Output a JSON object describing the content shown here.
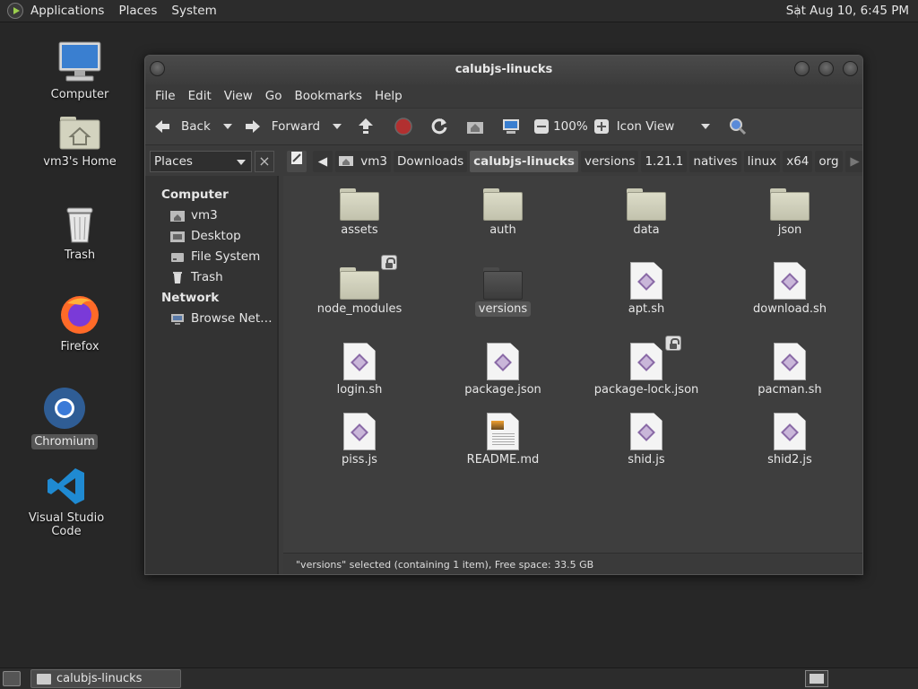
{
  "top_panel": {
    "menus": [
      "Applications",
      "Places",
      "System"
    ],
    "clock": "Sat Aug 10,  6:45 PM"
  },
  "desktop_icons": [
    {
      "label": "Computer",
      "icon": "computer-icon"
    },
    {
      "label": "vm3's Home",
      "icon": "home-folder-icon"
    },
    {
      "label": "Trash",
      "icon": "trash-icon"
    },
    {
      "label": "Firefox",
      "icon": "firefox-icon"
    },
    {
      "label": "Chromium",
      "icon": "chromium-icon",
      "selected": true
    },
    {
      "label": "Visual Studio Code",
      "icon": "vscode-icon"
    }
  ],
  "window": {
    "title": "calubjs-linucks",
    "menu": [
      "File",
      "Edit",
      "View",
      "Go",
      "Bookmarks",
      "Help"
    ],
    "toolbar": {
      "back": "Back",
      "forward": "Forward",
      "zoom": "100%",
      "view_mode": "Icon View"
    },
    "places_combo": "Places",
    "breadcrumbs": [
      "vm3",
      "Downloads",
      "calubjs-linucks",
      "versions",
      "1.21.1",
      "natives",
      "linux",
      "x64",
      "org"
    ],
    "active_crumb": "calubjs-linucks",
    "sidebar": {
      "computer_head": "Computer",
      "computer_items": [
        {
          "label": "vm3",
          "icon": "home-icon"
        },
        {
          "label": "Desktop",
          "icon": "desktop-icon"
        },
        {
          "label": "File System",
          "icon": "drive-icon"
        },
        {
          "label": "Trash",
          "icon": "trash-icon"
        }
      ],
      "network_head": "Network",
      "network_items": [
        {
          "label": "Browse Net…",
          "icon": "network-icon"
        }
      ]
    },
    "files": [
      {
        "name": "assets",
        "type": "folder"
      },
      {
        "name": "auth",
        "type": "folder"
      },
      {
        "name": "data",
        "type": "folder"
      },
      {
        "name": "json",
        "type": "folder"
      },
      {
        "name": "node_modules",
        "type": "folder",
        "locked": true
      },
      {
        "name": "versions",
        "type": "folder",
        "selected": true
      },
      {
        "name": "apt.sh",
        "type": "script"
      },
      {
        "name": "download.sh",
        "type": "script"
      },
      {
        "name": "login.sh",
        "type": "script"
      },
      {
        "name": "package.json",
        "type": "script"
      },
      {
        "name": "package-lock.json",
        "type": "script",
        "locked": true
      },
      {
        "name": "pacman.sh",
        "type": "script"
      },
      {
        "name": "piss.js",
        "type": "script"
      },
      {
        "name": "README.md",
        "type": "document"
      },
      {
        "name": "shid.js",
        "type": "script"
      },
      {
        "name": "shid2.js",
        "type": "script"
      }
    ],
    "status": "\"versions\" selected (containing 1 item), Free space: 33.5 GB"
  },
  "bottom_panel": {
    "task_label": "calubjs-linucks"
  },
  "colors": {
    "panel": "#2c2c2c",
    "desktop": "#272727",
    "window_bg": "#3e3e3e",
    "folder": "#dcdcc8",
    "script_accent": "#8a6aa6"
  }
}
